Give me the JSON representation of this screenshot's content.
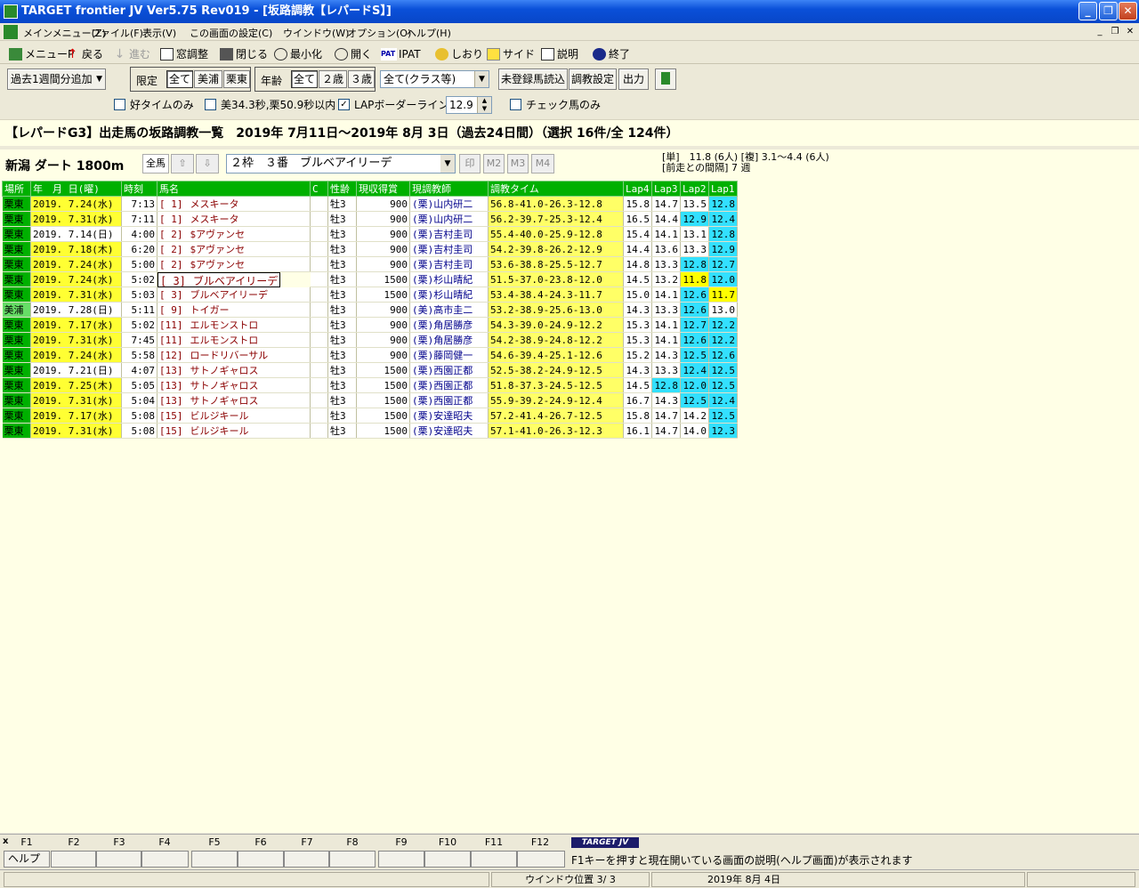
{
  "window": {
    "title": "TARGET frontier JV  Ver5.75  Rev019 - [坂路調教【レパードS】]"
  },
  "menu": [
    "メインメニュー(Z)",
    "ファイル(F)",
    "表示(V)",
    "この画面の設定(C)",
    "ウインドウ(W)",
    "オプション(O)",
    "ヘルプ(H)"
  ],
  "toolbar": [
    "メニューP",
    "戻る",
    "進む",
    "窓調整",
    "閉じる",
    "最小化",
    "開く",
    "IPAT",
    "しおり",
    "サイド",
    "説明",
    "終了"
  ],
  "toolbar_ipat_badge": "PAT",
  "controls": {
    "period_label": "過去1週間分追加",
    "limit_label": "限定",
    "limit_options": [
      "全て",
      "美浦",
      "栗東"
    ],
    "age_label": "年齢",
    "age_options": [
      "全て",
      "２歳",
      "３歳"
    ],
    "class_select": "全て(クラス等)",
    "unregistered_button": "未登録馬読込",
    "training_settings_button": "調教設定",
    "output_button": "出力",
    "good_time_check": "好タイムのみ",
    "time_filter_check": "美34.3秒,栗50.9秒以内",
    "lap_border_check": "LAPボーダーライン",
    "lap_border_value": "12.9",
    "check_horse_check": "チェック馬のみ"
  },
  "headline": "【レパードG3】出走馬の坂路調教一覧　2019年 7月11日～2019年 8月 3日（過去24日間）（選択 16件/全 124件）",
  "race": {
    "course": "新潟 ダート 1800m",
    "all_horses_label": "全馬",
    "selected_horse": "２枠　３番　ブルベアイリーデ",
    "mark_buttons": [
      "印",
      "M2",
      "M3",
      "M4"
    ],
    "odds_line1": "[単]　11.8 (6人) [複] 3.1～4.4 (6人)",
    "odds_line2": "[前走との間隔] 7 週"
  },
  "table": {
    "headers": [
      "場所",
      "年　月 日(曜)",
      "時刻",
      "馬名",
      "C",
      "性齢",
      "現収得賞",
      "現調教師",
      "調教タイム",
      "Lap4",
      "Lap3",
      "Lap2",
      "Lap1"
    ],
    "rows": [
      {
        "place": "栗東",
        "date": "2019. 7.24(水)",
        "hl": true,
        "time": "7:13",
        "no": "[ 1]",
        "horse": "メスキータ",
        "sex": "牡3",
        "prize": "900",
        "trainer": "(栗)山内研二",
        "times": "56.8-41.0-26.3-12.8",
        "l4": "15.8",
        "l3": "14.7",
        "l2": "13.5",
        "l1": "12.8",
        "l4c": "",
        "l3c": "",
        "l2c": "",
        "l1c": "cyan"
      },
      {
        "place": "栗東",
        "date": "2019. 7.31(水)",
        "hl": true,
        "time": "7:11",
        "no": "[ 1]",
        "horse": "メスキータ",
        "sex": "牡3",
        "prize": "900",
        "trainer": "(栗)山内研二",
        "times": "56.2-39.7-25.3-12.4",
        "l4": "16.5",
        "l3": "14.4",
        "l2": "12.9",
        "l1": "12.4",
        "l4c": "",
        "l3c": "",
        "l2c": "cyan",
        "l1c": "cyan"
      },
      {
        "place": "栗東",
        "date": "2019. 7.14(日)",
        "hl": false,
        "time": "4:00",
        "no": "[ 2]",
        "horse": "$アヴァンセ",
        "sex": "牡3",
        "prize": "900",
        "trainer": "(栗)吉村圭司",
        "times": "55.4-40.0-25.9-12.8",
        "l4": "15.4",
        "l3": "14.1",
        "l2": "13.1",
        "l1": "12.8",
        "l4c": "",
        "l3c": "",
        "l2c": "",
        "l1c": "cyan"
      },
      {
        "place": "栗東",
        "date": "2019. 7.18(木)",
        "hl": true,
        "time": "6:20",
        "no": "[ 2]",
        "horse": "$アヴァンセ",
        "sex": "牡3",
        "prize": "900",
        "trainer": "(栗)吉村圭司",
        "times": "54.2-39.8-26.2-12.9",
        "l4": "14.4",
        "l3": "13.6",
        "l2": "13.3",
        "l1": "12.9",
        "l4c": "",
        "l3c": "",
        "l2c": "",
        "l1c": "cyan"
      },
      {
        "place": "栗東",
        "date": "2019. 7.24(水)",
        "hl": true,
        "time": "5:00",
        "no": "[ 2]",
        "horse": "$アヴァンセ",
        "sex": "牡3",
        "prize": "900",
        "trainer": "(栗)吉村圭司",
        "times": "53.6-38.8-25.5-12.7",
        "l4": "14.8",
        "l3": "13.3",
        "l2": "12.8",
        "l1": "12.7",
        "l4c": "",
        "l3c": "",
        "l2c": "cyan",
        "l1c": "cyan"
      },
      {
        "place": "栗東",
        "date": "2019. 7.24(水)",
        "hl": true,
        "time": "5:02",
        "no": "[ 3]",
        "horse": "ブルベアイリーデ",
        "sex": "牡3",
        "prize": "1500",
        "trainer": "(栗)杉山晴紀",
        "times": "51.5-37.0-23.8-12.0",
        "l4": "14.5",
        "l3": "13.2",
        "l2": "11.8",
        "l1": "12.0",
        "l4c": "",
        "l3c": "",
        "l2c": "yel",
        "l1c": "cyan",
        "sel": true
      },
      {
        "place": "栗東",
        "date": "2019. 7.31(水)",
        "hl": true,
        "time": "5:03",
        "no": "[ 3]",
        "horse": "ブルベアイリーデ",
        "sex": "牡3",
        "prize": "1500",
        "trainer": "(栗)杉山晴紀",
        "times": "53.4-38.4-24.3-11.7",
        "l4": "15.0",
        "l3": "14.1",
        "l2": "12.6",
        "l1": "11.7",
        "l4c": "",
        "l3c": "",
        "l2c": "cyan",
        "l1c": "yel"
      },
      {
        "place": "美浦",
        "date": "2019. 7.28(日)",
        "hl": false,
        "time": "5:11",
        "no": "[ 9]",
        "horse": "トイガー",
        "sex": "牡3",
        "prize": "900",
        "trainer": "(美)高市圭二",
        "times": "53.2-38.9-25.6-13.0",
        "l4": "14.3",
        "l3": "13.3",
        "l2": "12.6",
        "l1": "13.0",
        "l4c": "",
        "l3c": "",
        "l2c": "cyan",
        "l1c": "",
        "miho": true
      },
      {
        "place": "栗東",
        "date": "2019. 7.17(水)",
        "hl": true,
        "time": "5:02",
        "no": "[11]",
        "horse": "エルモンストロ",
        "sex": "牡3",
        "prize": "900",
        "trainer": "(栗)角居勝彦",
        "times": "54.3-39.0-24.9-12.2",
        "l4": "15.3",
        "l3": "14.1",
        "l2": "12.7",
        "l1": "12.2",
        "l4c": "",
        "l3c": "",
        "l2c": "cyan",
        "l1c": "cyan"
      },
      {
        "place": "栗東",
        "date": "2019. 7.31(水)",
        "hl": true,
        "time": "7:45",
        "no": "[11]",
        "horse": "エルモンストロ",
        "sex": "牡3",
        "prize": "900",
        "trainer": "(栗)角居勝彦",
        "times": "54.2-38.9-24.8-12.2",
        "l4": "15.3",
        "l3": "14.1",
        "l2": "12.6",
        "l1": "12.2",
        "l4c": "",
        "l3c": "",
        "l2c": "cyan",
        "l1c": "cyan"
      },
      {
        "place": "栗東",
        "date": "2019. 7.24(水)",
        "hl": true,
        "time": "5:58",
        "no": "[12]",
        "horse": "ロードリバーサル",
        "sex": "牡3",
        "prize": "900",
        "trainer": "(栗)藤岡健一",
        "times": "54.6-39.4-25.1-12.6",
        "l4": "15.2",
        "l3": "14.3",
        "l2": "12.5",
        "l1": "12.6",
        "l4c": "",
        "l3c": "",
        "l2c": "cyan",
        "l1c": "cyan"
      },
      {
        "place": "栗東",
        "date": "2019. 7.21(日)",
        "hl": false,
        "time": "4:07",
        "no": "[13]",
        "horse": "サトノギャロス",
        "sex": "牡3",
        "prize": "1500",
        "trainer": "(栗)西園正都",
        "times": "52.5-38.2-24.9-12.5",
        "l4": "14.3",
        "l3": "13.3",
        "l2": "12.4",
        "l1": "12.5",
        "l4c": "",
        "l3c": "",
        "l2c": "cyan",
        "l1c": "cyan"
      },
      {
        "place": "栗東",
        "date": "2019. 7.25(木)",
        "hl": true,
        "time": "5:05",
        "no": "[13]",
        "horse": "サトノギャロス",
        "sex": "牡3",
        "prize": "1500",
        "trainer": "(栗)西園正都",
        "times": "51.8-37.3-24.5-12.5",
        "l4": "14.5",
        "l3": "12.8",
        "l2": "12.0",
        "l1": "12.5",
        "l4c": "",
        "l3c": "cyan",
        "l2c": "cyan",
        "l1c": "cyan"
      },
      {
        "place": "栗東",
        "date": "2019. 7.31(水)",
        "hl": true,
        "time": "5:04",
        "no": "[13]",
        "horse": "サトノギャロス",
        "sex": "牡3",
        "prize": "1500",
        "trainer": "(栗)西園正都",
        "times": "55.9-39.2-24.9-12.4",
        "l4": "16.7",
        "l3": "14.3",
        "l2": "12.5",
        "l1": "12.4",
        "l4c": "",
        "l3c": "",
        "l2c": "cyan",
        "l1c": "cyan"
      },
      {
        "place": "栗東",
        "date": "2019. 7.17(水)",
        "hl": true,
        "time": "5:08",
        "no": "[15]",
        "horse": "ビルジキール",
        "sex": "牡3",
        "prize": "1500",
        "trainer": "(栗)安達昭夫",
        "times": "57.2-41.4-26.7-12.5",
        "l4": "15.8",
        "l3": "14.7",
        "l2": "14.2",
        "l1": "12.5",
        "l4c": "",
        "l3c": "",
        "l2c": "",
        "l1c": "cyan"
      },
      {
        "place": "栗東",
        "date": "2019. 7.31(水)",
        "hl": true,
        "time": "5:08",
        "no": "[15]",
        "horse": "ビルジキール",
        "sex": "牡3",
        "prize": "1500",
        "trainer": "(栗)安達昭夫",
        "times": "57.1-41.0-26.3-12.3",
        "l4": "16.1",
        "l3": "14.7",
        "l2": "14.0",
        "l1": "12.3",
        "l4c": "",
        "l3c": "",
        "l2c": "",
        "l1c": "cyan"
      }
    ]
  },
  "fkeys": {
    "labels": [
      "F1",
      "F2",
      "F3",
      "F4",
      "F5",
      "F6",
      "F7",
      "F8",
      "F9",
      "F10",
      "F11",
      "F12"
    ],
    "f1_button": "ヘルプ",
    "brand": "TARGET JV",
    "help_text": "F1キーを押すと現在開いている画面の説明(ヘルプ画面)が表示されます"
  },
  "status": {
    "window_pos": "ウインドウ位置 3/ 3",
    "date": "2019年 8月 4日"
  }
}
